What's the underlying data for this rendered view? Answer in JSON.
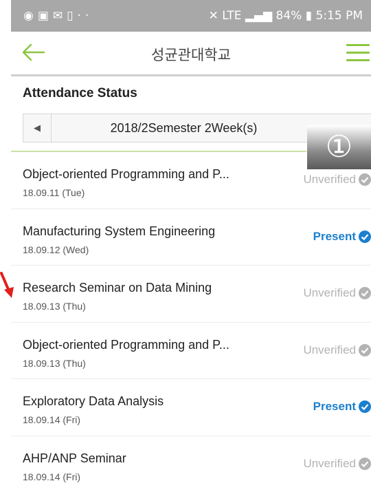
{
  "status_bar": {
    "left_icons": [
      "app-icon",
      "image-icon",
      "mail-icon",
      "mobile-icon",
      "more-icon"
    ],
    "right_text": "84%",
    "time": "5:15 PM",
    "signal_text": "LTE",
    "bg_color": "#a8a8a8"
  },
  "app_bar": {
    "title": "성균관대학교",
    "accent_color": "#8cc63f"
  },
  "section_title": "Attendance Status",
  "week_selector": {
    "label": "2018/2Semester 2Week(s)"
  },
  "badge": "①",
  "rows": [
    {
      "title": "Object-oriented Programming and P...",
      "date": "18.09.11 (Tue)",
      "status": "Unverified",
      "status_type": "unverified"
    },
    {
      "title": "Manufacturing System Engineering",
      "date": "18.09.12 (Wed)",
      "status": "Present",
      "status_type": "present"
    },
    {
      "title": "Research Seminar on Data Mining",
      "date": "18.09.13 (Thu)",
      "status": "Unverified",
      "status_type": "unverified"
    },
    {
      "title": "Object-oriented Programming and P...",
      "date": "18.09.13 (Thu)",
      "status": "Unverified",
      "status_type": "unverified"
    },
    {
      "title": "Exploratory Data Analysis",
      "date": "18.09.14 (Fri)",
      "status": "Present",
      "status_type": "present"
    },
    {
      "title": "AHP/ANP Seminar",
      "date": "18.09.14 (Fri)",
      "status": "Unverified",
      "status_type": "unverified"
    }
  ],
  "colors": {
    "present": "#1b7fcf",
    "unverified": "#b3b3b3",
    "annotation_arrow": "#e0201b"
  }
}
